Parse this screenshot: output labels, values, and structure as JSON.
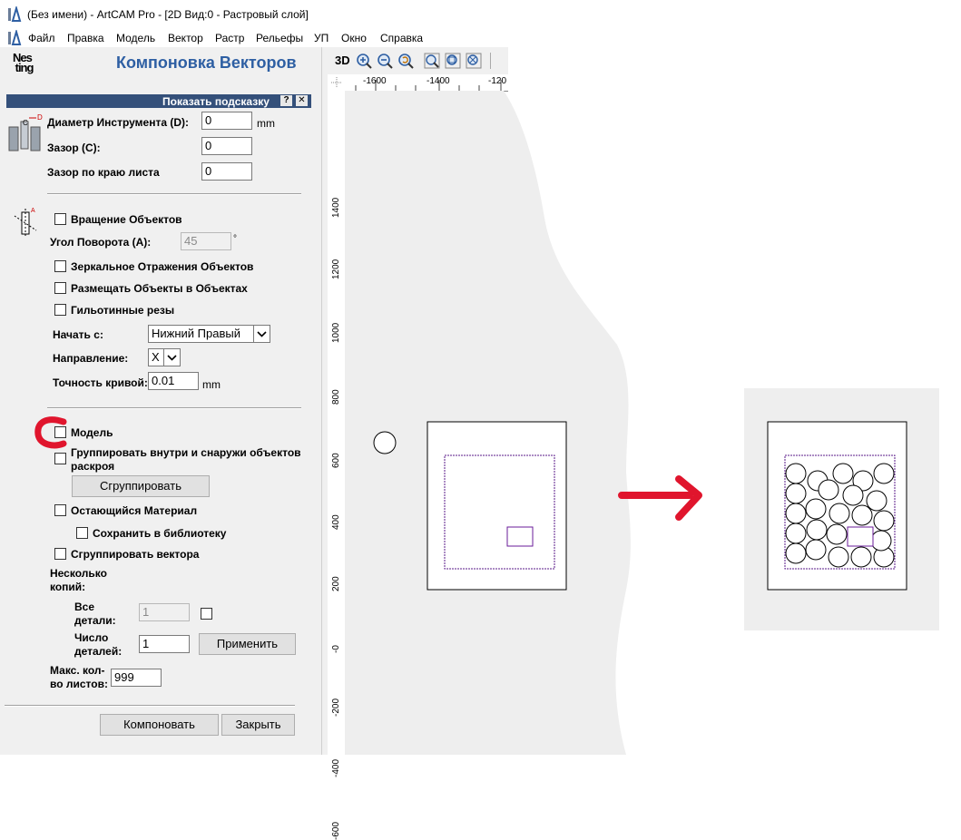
{
  "window": {
    "title": "(Без имени) - ArtCAM Pro - [2D Вид:0 - Растровый слой]"
  },
  "menu": [
    "Файл",
    "Правка",
    "Модель",
    "Вектор",
    "Растр",
    "Рельефы",
    "УП",
    "Окно",
    "Справка"
  ],
  "panel": {
    "logo_text": "Nes ting",
    "title": "Компоновка Векторов",
    "hint_bar": "Показать подсказку",
    "hint_help": "?",
    "hint_close": "✕",
    "tool_diameter_label": "Диаметр Инструмента (D):",
    "tool_diameter_value": "0",
    "tool_diameter_unit": "mm",
    "gap_label": "Зазор (C):",
    "gap_value": "0",
    "edge_gap_label": "Зазор по краю листа",
    "edge_gap_value": "0",
    "icon_tool_letters": "C D",
    "rotate_label": "Вращение Объектов",
    "angle_label": "Угол Поворота (A):",
    "angle_value": "45",
    "angle_unit": "°",
    "mirror_label": "Зеркальное Отражения Объектов",
    "nest_in_label": "Размещать Объекты в Объектах",
    "guillotine_label": "Гильотинные резы",
    "start_label": "Начать с:",
    "start_value": "Нижний Правый",
    "direction_label": "Направление:",
    "direction_value": "X",
    "accuracy_label": "Точность кривой:",
    "accuracy_value": "0.01",
    "accuracy_unit": "mm",
    "model_label": "Модель",
    "group_in_out_label_1": "Группировать внутри и снаружи объектов",
    "group_in_out_label_2": "раскроя",
    "group_button": "Сгруппировать",
    "remaining_label": "Остающийся Материал",
    "save_lib_label": "Сохранить в библиотеку",
    "group_vectors_label": "Сгруппировать вектора",
    "copies_label_1": "Несколько",
    "copies_label_2": "копий:",
    "all_parts_label_1": "Все",
    "all_parts_label_2": "детали:",
    "all_parts_value": "1",
    "num_parts_label_1": "Число",
    "num_parts_label_2": "деталей:",
    "num_parts_value": "1",
    "apply_button": "Применить",
    "max_sheets_label_1": "Макс. кол-",
    "max_sheets_label_2": "во листов:",
    "max_sheets_value": "999",
    "nest_button": "Компоновать",
    "close_button": "Закрыть"
  },
  "view": {
    "label_3d": "3D",
    "ruler_top": [
      "-1600",
      "-1400",
      "-120"
    ],
    "ruler_left": [
      "1400",
      "1200",
      "1000",
      "800",
      "600",
      "400",
      "200",
      "-0",
      "-200",
      "-400",
      "-600"
    ]
  },
  "colors": {
    "panel_bg": "#f0f0f0",
    "title_blue": "#2e5fa3",
    "hint_bar": "#34507a",
    "annotation_red": "#e0152d",
    "vector_purple": "#6a1b9a"
  }
}
